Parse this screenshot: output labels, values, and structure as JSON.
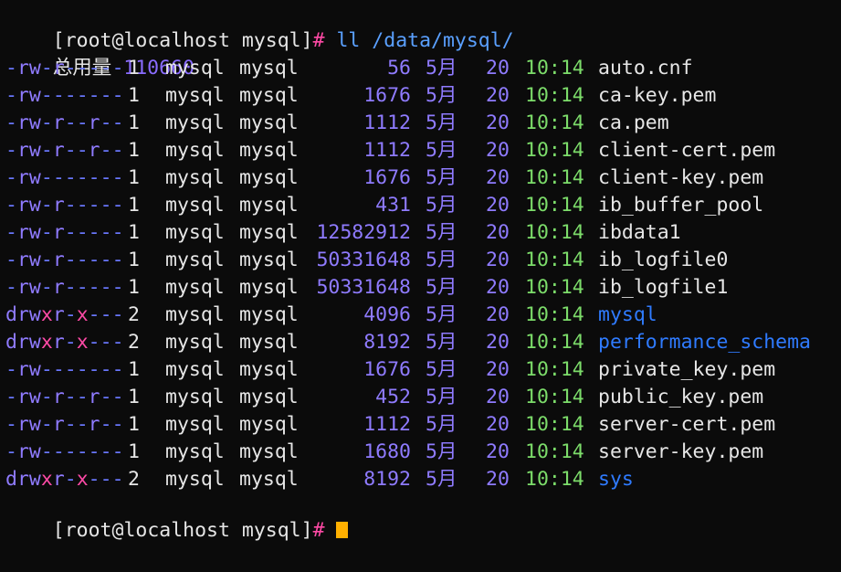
{
  "terminal": {
    "prompt": "[root@localhost mysql]",
    "prompt_symbol": "#",
    "command": "ll /data/mysql/",
    "total_label": "总用量",
    "total_value": "110660",
    "last_prompt": "[root@localhost mysql]",
    "last_prompt_symbol": "#"
  },
  "listing": [
    {
      "perm": "-rw-r-----",
      "links": "1",
      "owner": "mysql",
      "group": "mysql",
      "size": "56",
      "month": "5月",
      "day": "20",
      "time": "10:14",
      "name": "auto.cnf",
      "type": "file"
    },
    {
      "perm": "-rw-------",
      "links": "1",
      "owner": "mysql",
      "group": "mysql",
      "size": "1676",
      "month": "5月",
      "day": "20",
      "time": "10:14",
      "name": "ca-key.pem",
      "type": "file"
    },
    {
      "perm": "-rw-r--r--",
      "links": "1",
      "owner": "mysql",
      "group": "mysql",
      "size": "1112",
      "month": "5月",
      "day": "20",
      "time": "10:14",
      "name": "ca.pem",
      "type": "file"
    },
    {
      "perm": "-rw-r--r--",
      "links": "1",
      "owner": "mysql",
      "group": "mysql",
      "size": "1112",
      "month": "5月",
      "day": "20",
      "time": "10:14",
      "name": "client-cert.pem",
      "type": "file"
    },
    {
      "perm": "-rw-------",
      "links": "1",
      "owner": "mysql",
      "group": "mysql",
      "size": "1676",
      "month": "5月",
      "day": "20",
      "time": "10:14",
      "name": "client-key.pem",
      "type": "file"
    },
    {
      "perm": "-rw-r-----",
      "links": "1",
      "owner": "mysql",
      "group": "mysql",
      "size": "431",
      "month": "5月",
      "day": "20",
      "time": "10:14",
      "name": "ib_buffer_pool",
      "type": "file"
    },
    {
      "perm": "-rw-r-----",
      "links": "1",
      "owner": "mysql",
      "group": "mysql",
      "size": "12582912",
      "month": "5月",
      "day": "20",
      "time": "10:14",
      "name": "ibdata1",
      "type": "file"
    },
    {
      "perm": "-rw-r-----",
      "links": "1",
      "owner": "mysql",
      "group": "mysql",
      "size": "50331648",
      "month": "5月",
      "day": "20",
      "time": "10:14",
      "name": "ib_logfile0",
      "type": "file"
    },
    {
      "perm": "-rw-r-----",
      "links": "1",
      "owner": "mysql",
      "group": "mysql",
      "size": "50331648",
      "month": "5月",
      "day": "20",
      "time": "10:14",
      "name": "ib_logfile1",
      "type": "file"
    },
    {
      "perm": "drwxr-x---",
      "links": "2",
      "owner": "mysql",
      "group": "mysql",
      "size": "4096",
      "month": "5月",
      "day": "20",
      "time": "10:14",
      "name": "mysql",
      "type": "dir"
    },
    {
      "perm": "drwxr-x---",
      "links": "2",
      "owner": "mysql",
      "group": "mysql",
      "size": "8192",
      "month": "5月",
      "day": "20",
      "time": "10:14",
      "name": "performance_schema",
      "type": "dir"
    },
    {
      "perm": "-rw-------",
      "links": "1",
      "owner": "mysql",
      "group": "mysql",
      "size": "1676",
      "month": "5月",
      "day": "20",
      "time": "10:14",
      "name": "private_key.pem",
      "type": "file"
    },
    {
      "perm": "-rw-r--r--",
      "links": "1",
      "owner": "mysql",
      "group": "mysql",
      "size": "452",
      "month": "5月",
      "day": "20",
      "time": "10:14",
      "name": "public_key.pem",
      "type": "file"
    },
    {
      "perm": "-rw-r--r--",
      "links": "1",
      "owner": "mysql",
      "group": "mysql",
      "size": "1112",
      "month": "5月",
      "day": "20",
      "time": "10:14",
      "name": "server-cert.pem",
      "type": "file"
    },
    {
      "perm": "-rw-------",
      "links": "1",
      "owner": "mysql",
      "group": "mysql",
      "size": "1680",
      "month": "5月",
      "day": "20",
      "time": "10:14",
      "name": "server-key.pem",
      "type": "file"
    },
    {
      "perm": "drwxr-x---",
      "links": "2",
      "owner": "mysql",
      "group": "mysql",
      "size": "8192",
      "month": "5月",
      "day": "20",
      "time": "10:14",
      "name": "sys",
      "type": "dir"
    }
  ],
  "colors": {
    "background": "#0b0b0b",
    "text": "#e6e6e6",
    "directory": "#2f7bff",
    "time": "#7cdc6a",
    "size": "#8f7bff",
    "cursor": "#ffb000"
  }
}
